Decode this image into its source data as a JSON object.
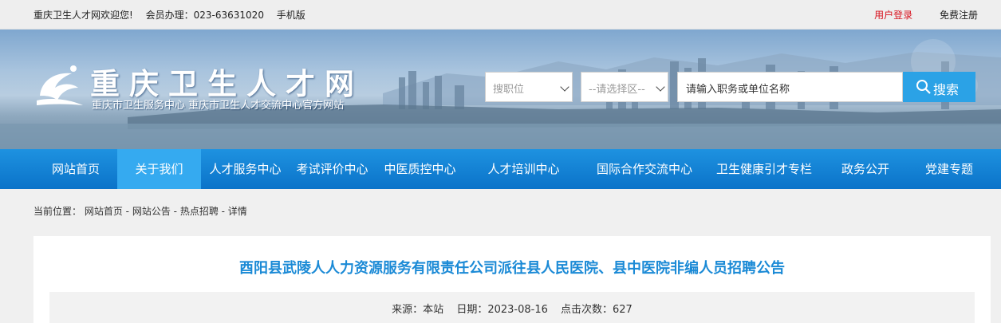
{
  "topbar": {
    "welcome": "重庆卫生人才网欢迎您!",
    "member": "会员办理：023-63631020",
    "mobile": "手机版",
    "login": "用户登录",
    "register": "免费注册"
  },
  "header": {
    "title": "重庆卫生人才网",
    "subtitle": "重庆市卫生服务中心 重庆市卫生人才交流中心官方网站"
  },
  "search": {
    "position_select": "搜职位",
    "region_select": "--请选择区--",
    "placeholder": "请输入职务或单位名称",
    "button": "搜索"
  },
  "nav": {
    "items": [
      {
        "label": "网站首页"
      },
      {
        "label": "关于我们",
        "active": true
      },
      {
        "label": "人才服务中心"
      },
      {
        "label": "考试评价中心"
      },
      {
        "label": "中医质控中心"
      },
      {
        "label": "人才培训中心"
      },
      {
        "label": "国际合作交流中心"
      },
      {
        "label": "卫生健康引才专栏"
      },
      {
        "label": "政务公开"
      },
      {
        "label": "党建专题"
      }
    ]
  },
  "breadcrumb": {
    "prefix": "当前位置：",
    "home": "网站首页",
    "sep1": " - ",
    "notice": "网站公告",
    "sep2": " - ",
    "hot": "热点招聘",
    "sep3": " - ",
    "detail": "详情"
  },
  "article": {
    "title": "酉阳县武陵人人力资源服务有限责任公司派往县人民医院、县中医院非编人员招聘公告",
    "source": "来源：本站",
    "date": "日期：2023-08-16",
    "clicks": "点击次数：627"
  },
  "colors": {
    "accent": "#1b8ad6",
    "nav": "#0b73c9",
    "nav_active": "#35aaf0",
    "login": "#d8131f"
  }
}
